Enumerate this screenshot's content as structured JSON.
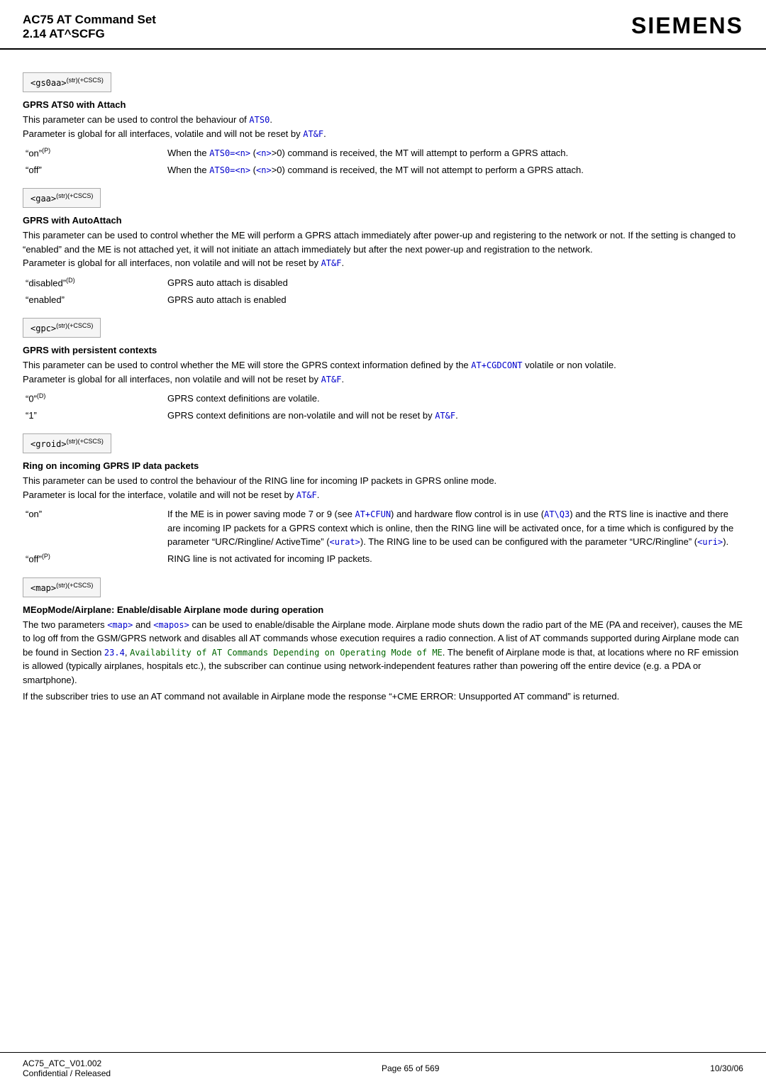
{
  "header": {
    "title": "AC75 AT Command Set",
    "subtitle": "2.14 AT^SCFG",
    "brand": "SIEMENS"
  },
  "footer": {
    "left_line1": "AC75_ATC_V01.002",
    "left_line2": "Confidential / Released",
    "center": "Page 65 of 569",
    "right": "10/30/06"
  },
  "sections": [
    {
      "id": "gs0aa",
      "param_label": "<gs0aa>",
      "param_sup": "(str)(+CSCS)",
      "heading": "GPRS ATS0 with Attach",
      "body": [
        "This parameter can be used to control the behaviour of ATS0.",
        "Parameter is global for all interfaces, volatile and will not be reset by AT&F."
      ],
      "defs": [
        {
          "term": "\"on\"",
          "term_sup": "(P)",
          "def": "When the ATS0=<n> (<n>>0) command is received, the MT will attempt to perform a GPRS attach."
        },
        {
          "term": "\"off\"",
          "term_sup": "",
          "def": "When the ATS0=<n> (<n>>0) command is received, the MT will not attempt to perform a GPRS attach."
        }
      ]
    },
    {
      "id": "gaa",
      "param_label": "<gaa>",
      "param_sup": "(str)(+CSCS)",
      "heading": "GPRS with AutoAttach",
      "body": [
        "This parameter can be used to control whether the ME will perform a GPRS attach immediately after power-up and registering to the network or not. If the setting is changed to \"enabled\" and the ME is not attached yet, it will not initiate an attach immediately but after the next power-up and registration to the network.",
        "Parameter is global for all interfaces, non volatile and will not be reset by AT&F."
      ],
      "defs": [
        {
          "term": "\"disabled\"",
          "term_sup": "(D)",
          "def": "GPRS auto attach is disabled"
        },
        {
          "term": "\"enabled\"",
          "term_sup": "",
          "def": "GPRS auto attach is enabled"
        }
      ]
    },
    {
      "id": "gpc",
      "param_label": "<gpc>",
      "param_sup": "(str)(+CSCS)",
      "heading": "GPRS with persistent contexts",
      "body": [
        "This parameter can be used to control whether the ME will store the GPRS context information defined by the AT+CGDCONT volatile or non volatile.",
        "Parameter is global for all interfaces, non volatile and will not be reset by AT&F."
      ],
      "defs": [
        {
          "term": "\"0\"",
          "term_sup": "(D)",
          "def": "GPRS context definitions are volatile."
        },
        {
          "term": "\"1\"",
          "term_sup": "",
          "def": "GPRS context definitions are non-volatile and will not be reset by AT&F."
        }
      ]
    },
    {
      "id": "groid",
      "param_label": "<groid>",
      "param_sup": "(str)(+CSCS)",
      "heading": "Ring on incoming GPRS IP data packets",
      "body": [
        "This parameter can be used to control the behaviour of the RING line for incoming IP packets in GPRS online mode.",
        "Parameter is local for the interface, volatile and will not be reset by AT&F."
      ],
      "defs": [
        {
          "term": "\"on\"",
          "term_sup": "",
          "def": "If the ME is in power saving mode 7 or 9 (see AT+CFUN) and hardware flow control is in use (AT\\Q3) and the RTS line is inactive and there are incoming IP packets for a GPRS context which is online, then the RING line will be activated once, for a time which is configured by the parameter \"URC/Ringline/ActiveTime\" (<urat>). The RING line to be used can be configured with the parameter \"URC/Ringline\" (<uri>)."
        },
        {
          "term": "\"off\"",
          "term_sup": "(P)",
          "def": "RING line is not activated for incoming IP packets."
        }
      ]
    },
    {
      "id": "map",
      "param_label": "<map>",
      "param_sup": "(str)(+CSCS)",
      "heading": "MEopMode/Airplane: Enable/disable Airplane mode during operation",
      "body": [
        "The two parameters <map> and <mapos> can be used to enable/disable the Airplane mode. Airplane mode shuts down the radio part of the ME (PA and receiver), causes the ME to log off from the GSM/GPRS network and disables all AT commands whose execution requires a radio connection. A list of AT commands supported during Airplane mode can be found in Section 23.4, Availability of AT Commands Depending on Operating Mode of ME. The benefit of Airplane mode is that, at locations where no RF emission is allowed (typically airplanes, hospitals etc.), the subscriber can continue using network-independent features rather than powering off the entire device (e.g. a PDA or smartphone).",
        "If the subscriber tries to use an AT command not available in Airplane mode the response \"+CME ERROR: Unsupported AT command\" is returned."
      ],
      "defs": []
    }
  ]
}
